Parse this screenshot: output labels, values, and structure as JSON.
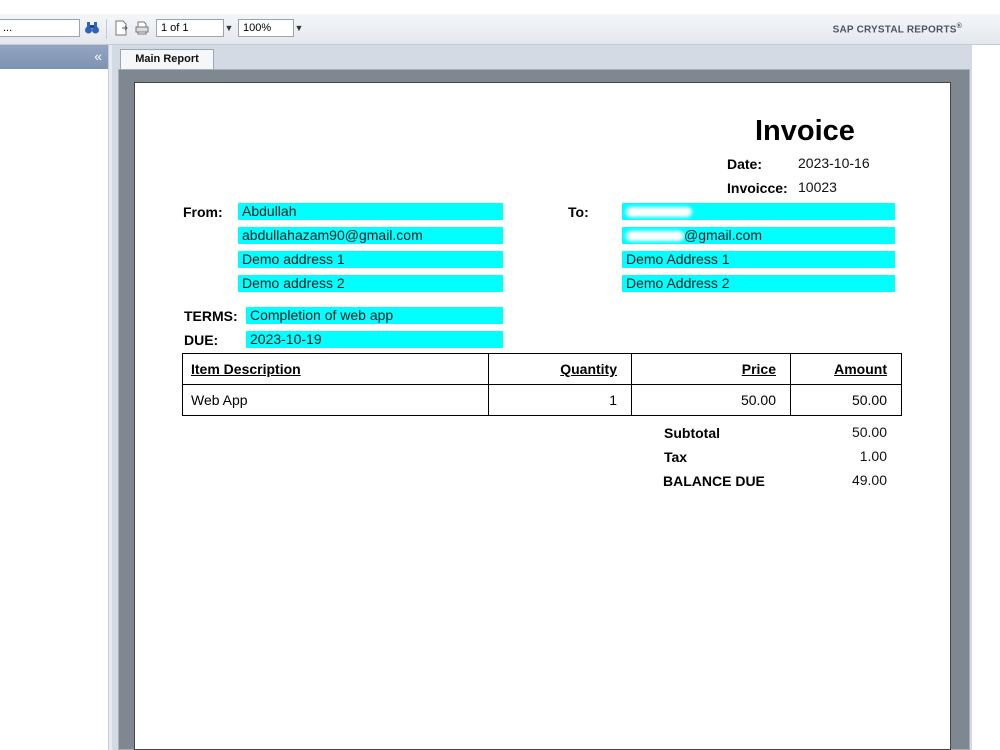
{
  "toolbar": {
    "search_value": "...",
    "page_indicator": "1 of 1",
    "zoom": "100%",
    "brand": "SAP CRYSTAL REPORTS",
    "brand_mark": "®"
  },
  "tabs": [
    {
      "label": "Main Report"
    }
  ],
  "invoice": {
    "title": "Invoice",
    "date_label": "Date:",
    "date_value": "2023-10-16",
    "number_label": "Invoicce:",
    "number_value": "10023",
    "from_label": "From:",
    "from_lines": [
      "Abdullah",
      "abdullahazam90@gmail.com",
      "Demo address 1",
      "Demo address 2"
    ],
    "to_label": "To:",
    "to_email_suffix": "@gmail.com",
    "to_address1": "Demo Address 1",
    "to_address2": "Demo Address 2",
    "terms_label": "TERMS:",
    "terms_value": "Completion of web app",
    "due_label": "DUE:",
    "due_value": "2023-10-19",
    "table": {
      "headers": [
        "Item Description",
        "Quantity",
        "Price",
        "Amount"
      ],
      "rows": [
        [
          "Web App",
          "1",
          "50.00",
          "50.00"
        ]
      ]
    },
    "totals": {
      "subtotal_label": "Subtotal",
      "subtotal_value": "50.00",
      "tax_label": "Tax",
      "tax_value": "1.00",
      "balance_label": "BALANCE DUE",
      "balance_value": "49.00"
    }
  },
  "colors": {
    "highlight": "#00ffff",
    "panel_header": "#8a9dbb"
  }
}
